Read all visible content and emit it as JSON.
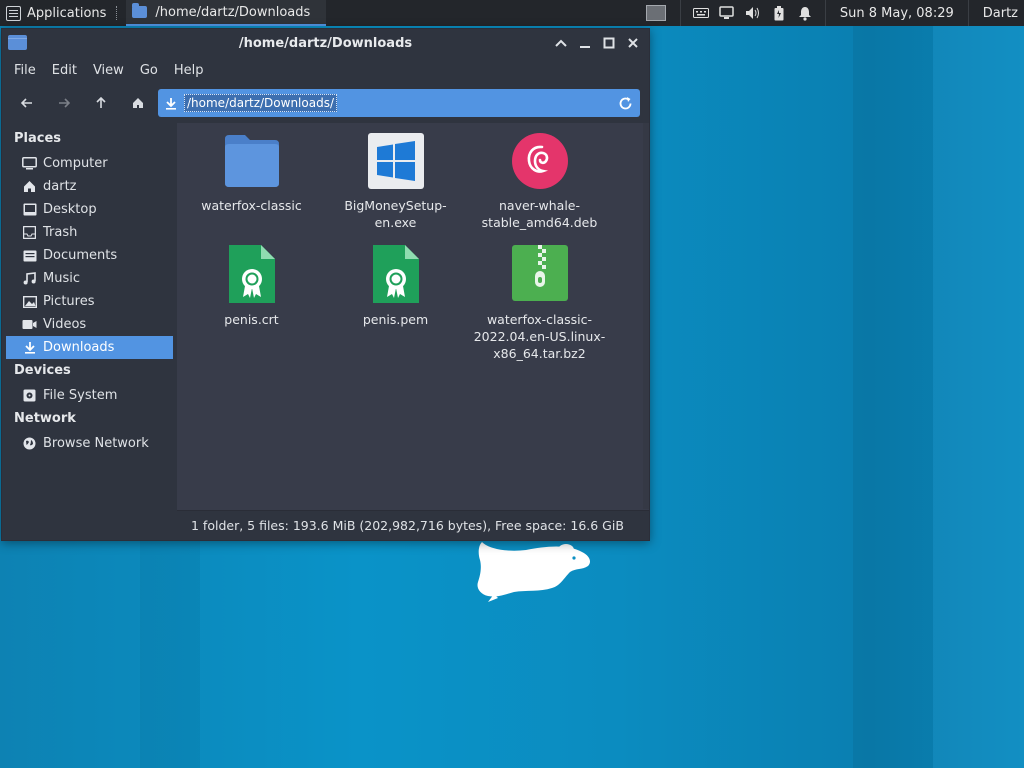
{
  "panel": {
    "applications_label": "Applications",
    "task_title": "/home/dartz/Downloads",
    "clock": "Sun  8 May, 08:29",
    "user": "Dartz",
    "tray_icons": [
      "keyboard-icon",
      "display-icon",
      "volume-icon",
      "battery-icon",
      "notification-bell-icon"
    ]
  },
  "window": {
    "title": "/home/dartz/Downloads",
    "controls": [
      "minimize",
      "maximize",
      "close"
    ]
  },
  "menubar": [
    "File",
    "Edit",
    "View",
    "Go",
    "Help"
  ],
  "toolbar": {
    "back": "←",
    "forward": "→",
    "up": "↑",
    "home": "⌂",
    "location": "/home/dartz/Downloads/"
  },
  "sidebar": {
    "places_heading": "Places",
    "places": [
      {
        "label": "Computer",
        "icon": "computer-icon"
      },
      {
        "label": "dartz",
        "icon": "home-icon"
      },
      {
        "label": "Desktop",
        "icon": "desktop-icon"
      },
      {
        "label": "Trash",
        "icon": "trash-icon"
      },
      {
        "label": "Documents",
        "icon": "documents-icon"
      },
      {
        "label": "Music",
        "icon": "music-icon"
      },
      {
        "label": "Pictures",
        "icon": "pictures-icon"
      },
      {
        "label": "Videos",
        "icon": "videos-icon"
      },
      {
        "label": "Downloads",
        "icon": "downloads-icon",
        "selected": true
      }
    ],
    "devices_heading": "Devices",
    "devices": [
      {
        "label": "File System",
        "icon": "drive-icon"
      }
    ],
    "network_heading": "Network",
    "network": [
      {
        "label": "Browse Network",
        "icon": "network-icon"
      }
    ]
  },
  "files": [
    {
      "name": "waterfox-classic",
      "icon": "folder-icon"
    },
    {
      "name": "BigMoneySetup-en.exe",
      "icon": "windows-exe-icon"
    },
    {
      "name": "naver-whale-stable_amd64.deb",
      "icon": "debian-package-icon"
    },
    {
      "name": "penis.crt",
      "icon": "certificate-icon"
    },
    {
      "name": "penis.pem",
      "icon": "certificate-icon"
    },
    {
      "name": "waterfox-classic-2022.04.en-US.linux-x86_64.tar.bz2",
      "icon": "archive-icon"
    }
  ],
  "status": "1 folder, 5 files: 193.6 MiB (202,982,716 bytes), Free space: 16.6 GiB",
  "colors": {
    "accent": "#5294e2",
    "window_bg": "#383c4a",
    "sidebar_bg": "#2f343f",
    "desktop_bg": "#0b8fc2"
  }
}
